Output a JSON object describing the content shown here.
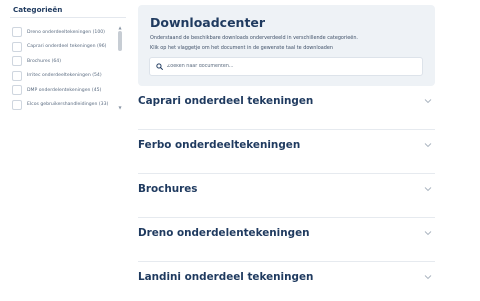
{
  "sidebar": {
    "title": "Categorieën",
    "items": [
      {
        "label": "Dreno onderdeeltekeningen (100)"
      },
      {
        "label": "Caprari onderdeel tekeningen (96)"
      },
      {
        "label": "Brochures (64)"
      },
      {
        "label": "Irritec onderdeeltekeningen (54)"
      },
      {
        "label": "DMP onderdelentekeningen (45)"
      },
      {
        "label": "Elcos gebruikershandleidingen (33)"
      }
    ]
  },
  "download_center": {
    "title": "Downloadcenter",
    "description_line1": "Onderstaand de beschikbare downloads onderverdeeld in verschillende categorieën.",
    "description_line2": "Klik op het vlaggetje om het document in de gewenste taal te downloaden",
    "search_placeholder": "Zoeken naar documenten..."
  },
  "sections": [
    {
      "label": "Caprari onderdeel tekeningen"
    },
    {
      "label": "Ferbo onderdeeltekeningen"
    },
    {
      "label": "Brochures"
    },
    {
      "label": "Dreno onderdelentekeningen"
    },
    {
      "label": "Landini onderdeel tekeningen"
    }
  ],
  "icons": {
    "search": "search-icon",
    "chevron": "chevron-down-icon",
    "scroll_up": "scroll-up-arrow",
    "scroll_down": "scroll-down-arrow"
  },
  "colors": {
    "heading": "#1f3a5f",
    "card_background": "#eef2f6"
  }
}
